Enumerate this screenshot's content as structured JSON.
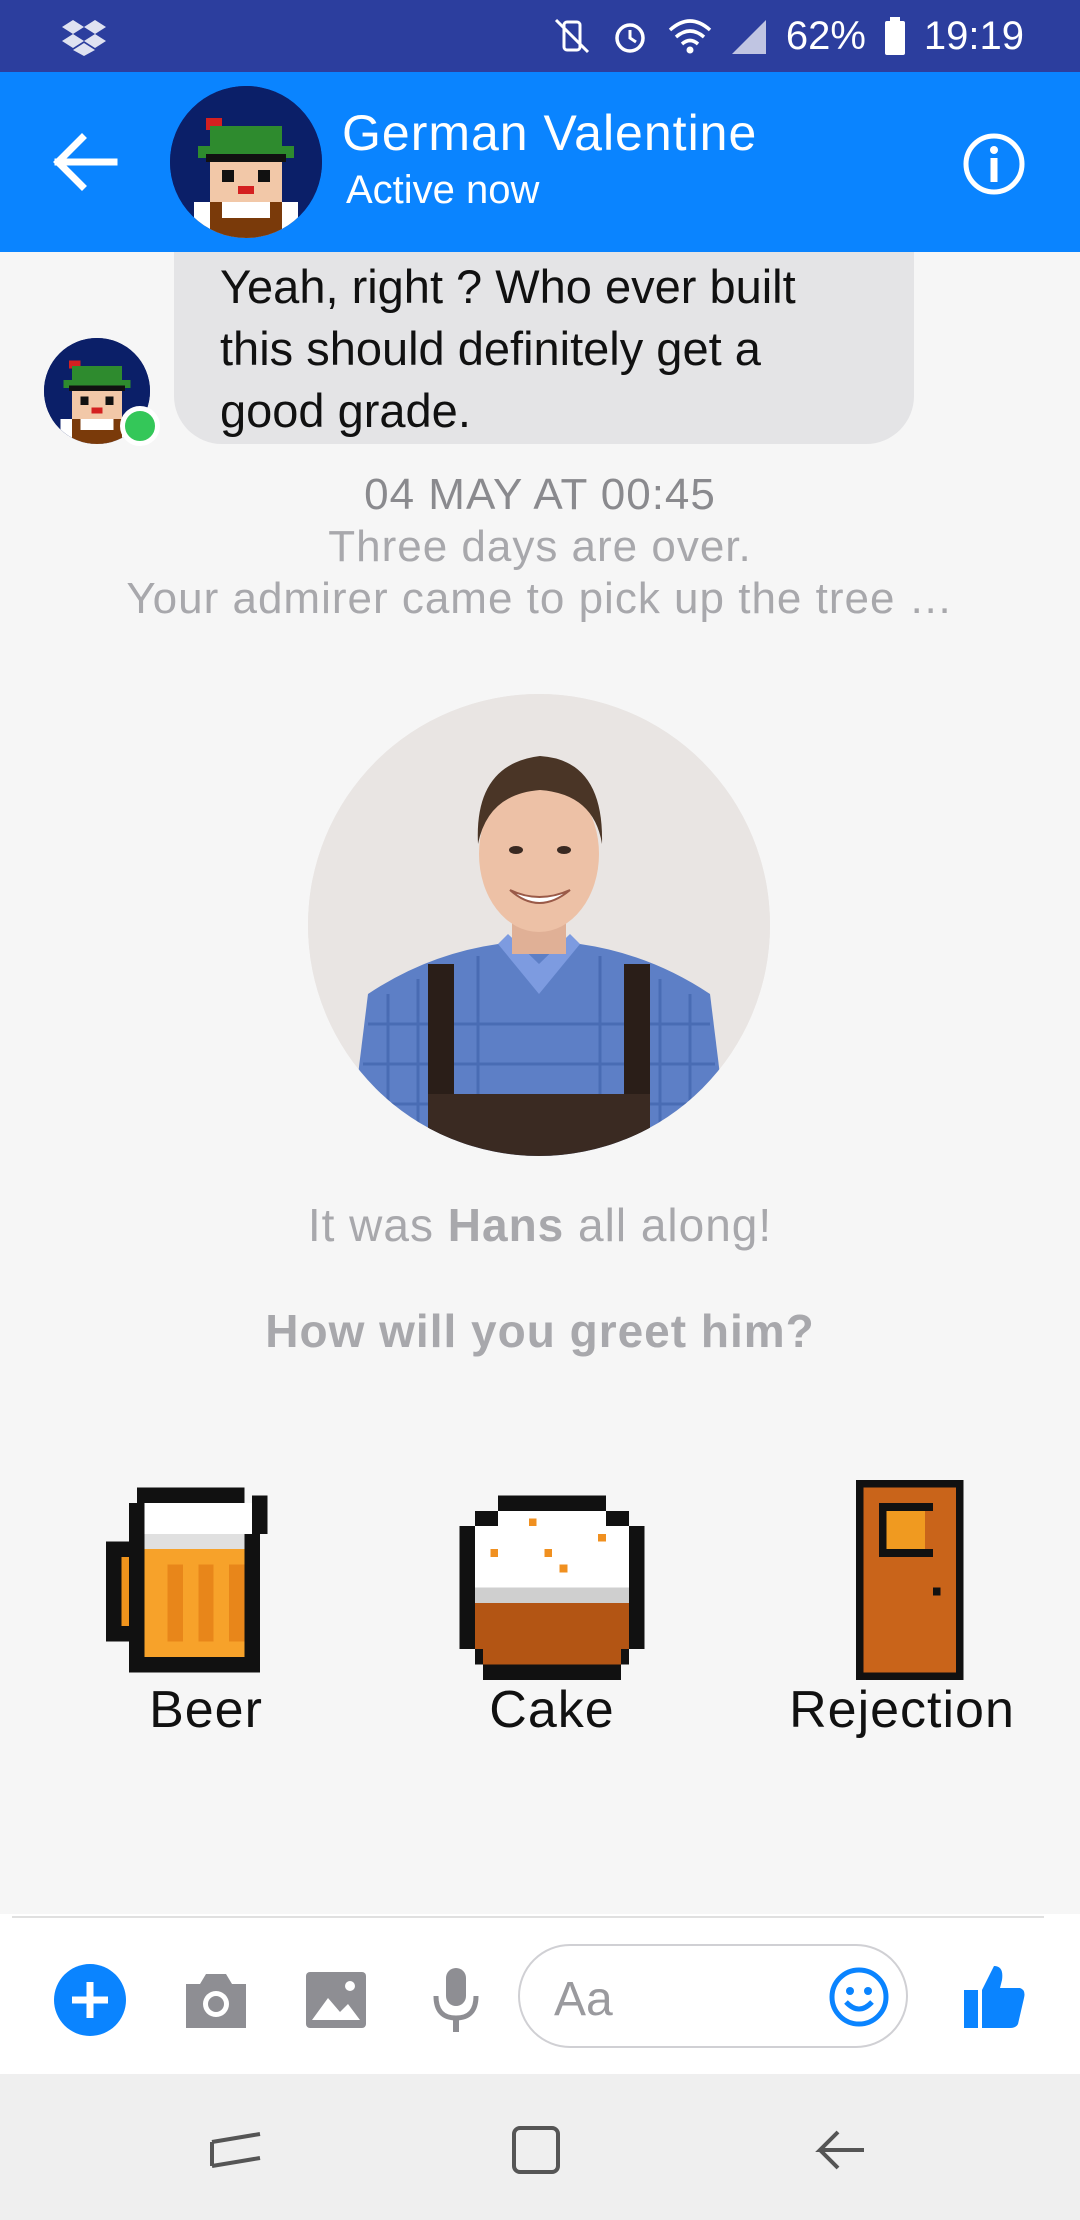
{
  "status_bar": {
    "battery": "62%",
    "time": "19:19",
    "icons": [
      "dropbox-icon",
      "mute-vibrate-icon",
      "alarm-icon",
      "wifi-icon",
      "signal-icon",
      "battery-icon"
    ]
  },
  "header": {
    "contact_name": "German Valentine",
    "status": "Active now",
    "accent_color": "#0a84ff"
  },
  "messages": {
    "bubble_text": "Yeah, right ? Who ever built this should definitely get a good grade.",
    "timestamp": "04 MAY AT 00:45",
    "story_line1": "Three days are over.",
    "story_line2": "Your admirer came to pick up the tree …",
    "reveal_prefix": "It was ",
    "reveal_name": "Hans",
    "reveal_suffix": " all along!",
    "question": "How will you greet him?"
  },
  "choices": [
    {
      "label": "Beer",
      "icon": "beer-mug-icon"
    },
    {
      "label": "Cake",
      "icon": "cake-icon"
    },
    {
      "label": "Rejection",
      "icon": "door-icon"
    }
  ],
  "composer": {
    "placeholder": "Aa",
    "icons": [
      "plus-icon",
      "camera-icon",
      "image-icon",
      "microphone-icon",
      "emoji-icon",
      "thumbs-up-icon"
    ]
  },
  "nav_bar": {
    "icons": [
      "recent-apps-icon",
      "home-icon",
      "back-icon"
    ]
  }
}
